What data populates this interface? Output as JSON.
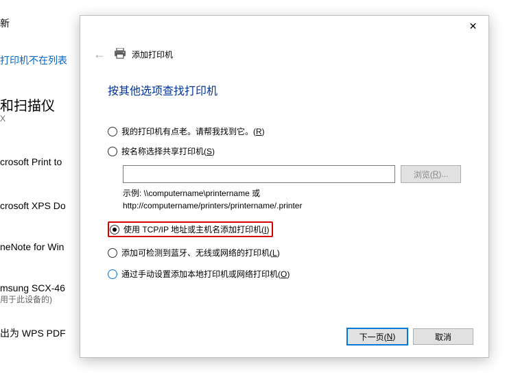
{
  "bg": {
    "refresh": "新",
    "not_in_list": "打印机不在列表",
    "section_heading": "和扫描仪",
    "section_sub": "X",
    "items": [
      {
        "title": "crosoft Print to"
      },
      {
        "title": "crosoft XPS Do"
      },
      {
        "title": "neNote for Win"
      },
      {
        "title": "msung SCX-46",
        "sub": "用于此设备的)"
      },
      {
        "title": "出为 WPS PDF"
      }
    ]
  },
  "dialog": {
    "close": "✕",
    "back": "←",
    "title": "添加打印机",
    "heading": "按其他选项查找打印机",
    "options": {
      "o1": {
        "label_pre": "我的打印机有点老。请帮我找到它。(",
        "key": "R",
        "label_post": ")"
      },
      "o2": {
        "label_pre": "按名称选择共享打印机(",
        "key": "S",
        "label_post": ")"
      },
      "browse": {
        "label_pre": "浏览(",
        "key": "R",
        "label_post": ")..."
      },
      "example_l1": "示例: \\\\computername\\printername 或",
      "example_l2": "http://computername/printers/printername/.printer",
      "o3": {
        "label_pre": "使用 TCP/IP 地址或主机名添加打印机(",
        "key": "I",
        "label_post": ")"
      },
      "o4": {
        "label_pre": "添加可检测到蓝牙、无线或网络的打印机(",
        "key": "L",
        "label_post": ")"
      },
      "o5": {
        "label_pre": "通过手动设置添加本地打印机或网络打印机(",
        "key": "O",
        "label_post": ")"
      }
    },
    "footer": {
      "next_pre": "下一页(",
      "next_key": "N",
      "next_post": ")",
      "cancel": "取消"
    }
  }
}
